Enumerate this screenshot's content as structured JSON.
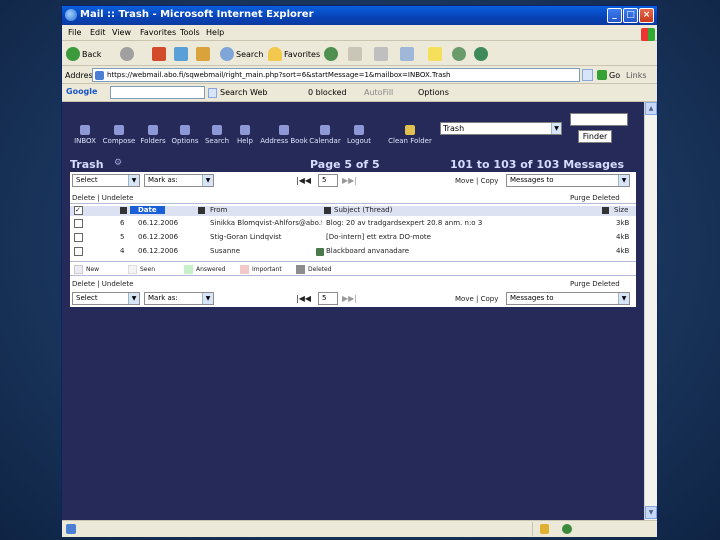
{
  "window": {
    "title": "Mail :: Trash - Microsoft Internet Explorer"
  },
  "menu": [
    "File",
    "Edit",
    "View",
    "Favorites",
    "Tools",
    "Help"
  ],
  "toolbar": {
    "back": "Back",
    "search": "Search",
    "favorites": "Favorites"
  },
  "address": {
    "label": "Address",
    "url": "https://webmail.abo.fi/sqwebmail/right_main.php?sort=6&startMessage=1&mailbox=INBOX.Trash",
    "go": "Go",
    "links": "Links"
  },
  "googlebar": {
    "brand": "Google",
    "search_web": "Search Web",
    "blocked": "0 blocked",
    "autofill": "AutoFill",
    "options": "Options"
  },
  "nav": [
    {
      "label": "INBOX"
    },
    {
      "label": "Compose"
    },
    {
      "label": "Folders"
    },
    {
      "label": "Options"
    },
    {
      "label": "Search"
    },
    {
      "label": "Help"
    },
    {
      "label": "Address Book"
    },
    {
      "label": "Calendar"
    },
    {
      "label": "Logout"
    },
    {
      "label": "Clean Folder"
    }
  ],
  "folder_select": "Trash",
  "search_go": "Finder",
  "header": {
    "folder": "Trash",
    "page": "Page 5 of 5",
    "range": "101 to 103 of 103 Messages"
  },
  "controls": {
    "select": "Select",
    "mark": "Mark as:",
    "page_input": "5",
    "move_copy": "Move | Copy",
    "move_target": "Messages to",
    "delete_undelete": "Delete | Undelete",
    "purge": "Purge Deleted"
  },
  "columns": {
    "date": "Date",
    "from": "From",
    "subject": "Subject (Thread)",
    "size": "Size"
  },
  "messages": [
    {
      "num": "6",
      "date": "06.12.2006",
      "from": "Sinikka Blomqvist-Ahlfors@abo.fi",
      "subject": "Blog: 20 av tradgardsexpert 20.8 anm. n:o 3",
      "size": "3kB"
    },
    {
      "num": "5",
      "date": "06.12.2006",
      "from": "Stig-Goran Lindqvist",
      "subject": "[Do-intern] ett extra DO-mote",
      "size": "4kB"
    },
    {
      "num": "4",
      "date": "06.12.2006",
      "from": "Susanne",
      "subject": "Blackboard anvanadare",
      "size": "4kB"
    }
  ],
  "legend": [
    "New",
    "Seen",
    "Answered",
    "Important",
    "Deleted"
  ],
  "bottom": {
    "select": "Select",
    "mark": "Mark as:",
    "page_input": "5",
    "move_target": "Messages to"
  },
  "colors": {
    "page_bg": "#262a58",
    "panel_bg": "#ffffff",
    "xp_title": "#0842b5",
    "desktop": "#1d3a64"
  }
}
